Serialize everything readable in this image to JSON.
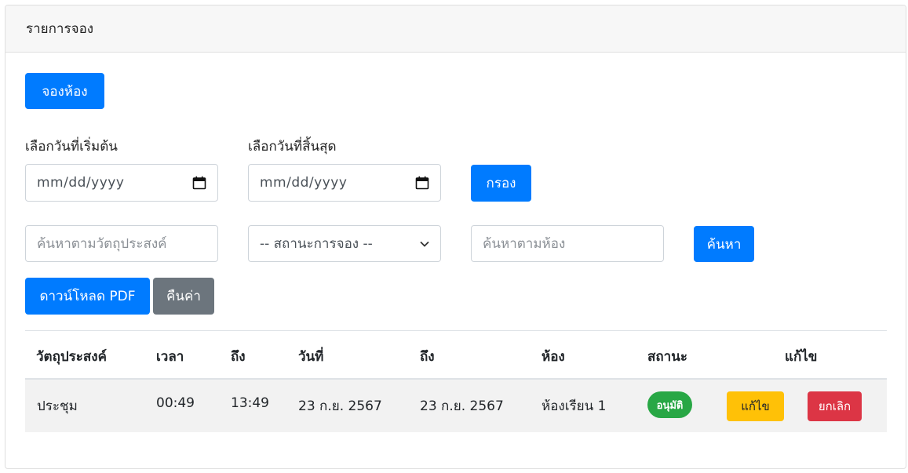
{
  "card": {
    "title": "รายการจอง"
  },
  "actions": {
    "book_room": "จองห้อง"
  },
  "filters": {
    "start_date_label": "เลือกวันที่เริ่มต้น",
    "end_date_label": "เลือกวันที่สิ้นสุด",
    "start_date_value": "mm/dd/yyyy",
    "end_date_value": "mm/dd/yyyy",
    "filter_button": "กรอง",
    "purpose_placeholder": "ค้นหาตามวัตถุประสงค์",
    "status_selected": "-- สถานะการจอง --",
    "room_placeholder": "ค้นหาตามห้อง",
    "search_button": "ค้นหา",
    "download_pdf": "ดาวน์โหลด PDF",
    "reset": "คืนค่า"
  },
  "table": {
    "headers": [
      "วัตถุประสงค์",
      "เวลา",
      "ถึง",
      "วันที่",
      "ถึง",
      "ห้อง",
      "สถานะ",
      "แก้ไข"
    ],
    "rows": [
      {
        "purpose": "ประชุม",
        "time_start": "00:49",
        "time_end": "13:49",
        "date_start": "23 ก.ย. 2567",
        "date_end": "23 ก.ย. 2567",
        "room": "ห้องเรียน 1",
        "status": "อนุมัติ",
        "edit": "แก้ไข",
        "cancel": "ยกเลิก"
      }
    ]
  },
  "colors": {
    "primary": "#007bff",
    "secondary": "#6c757d",
    "success": "#28a745",
    "warning": "#ffc107",
    "danger": "#dc3545"
  },
  "icons": {
    "date_picker": "calendar-icon",
    "select": "chevron-down-icon"
  }
}
